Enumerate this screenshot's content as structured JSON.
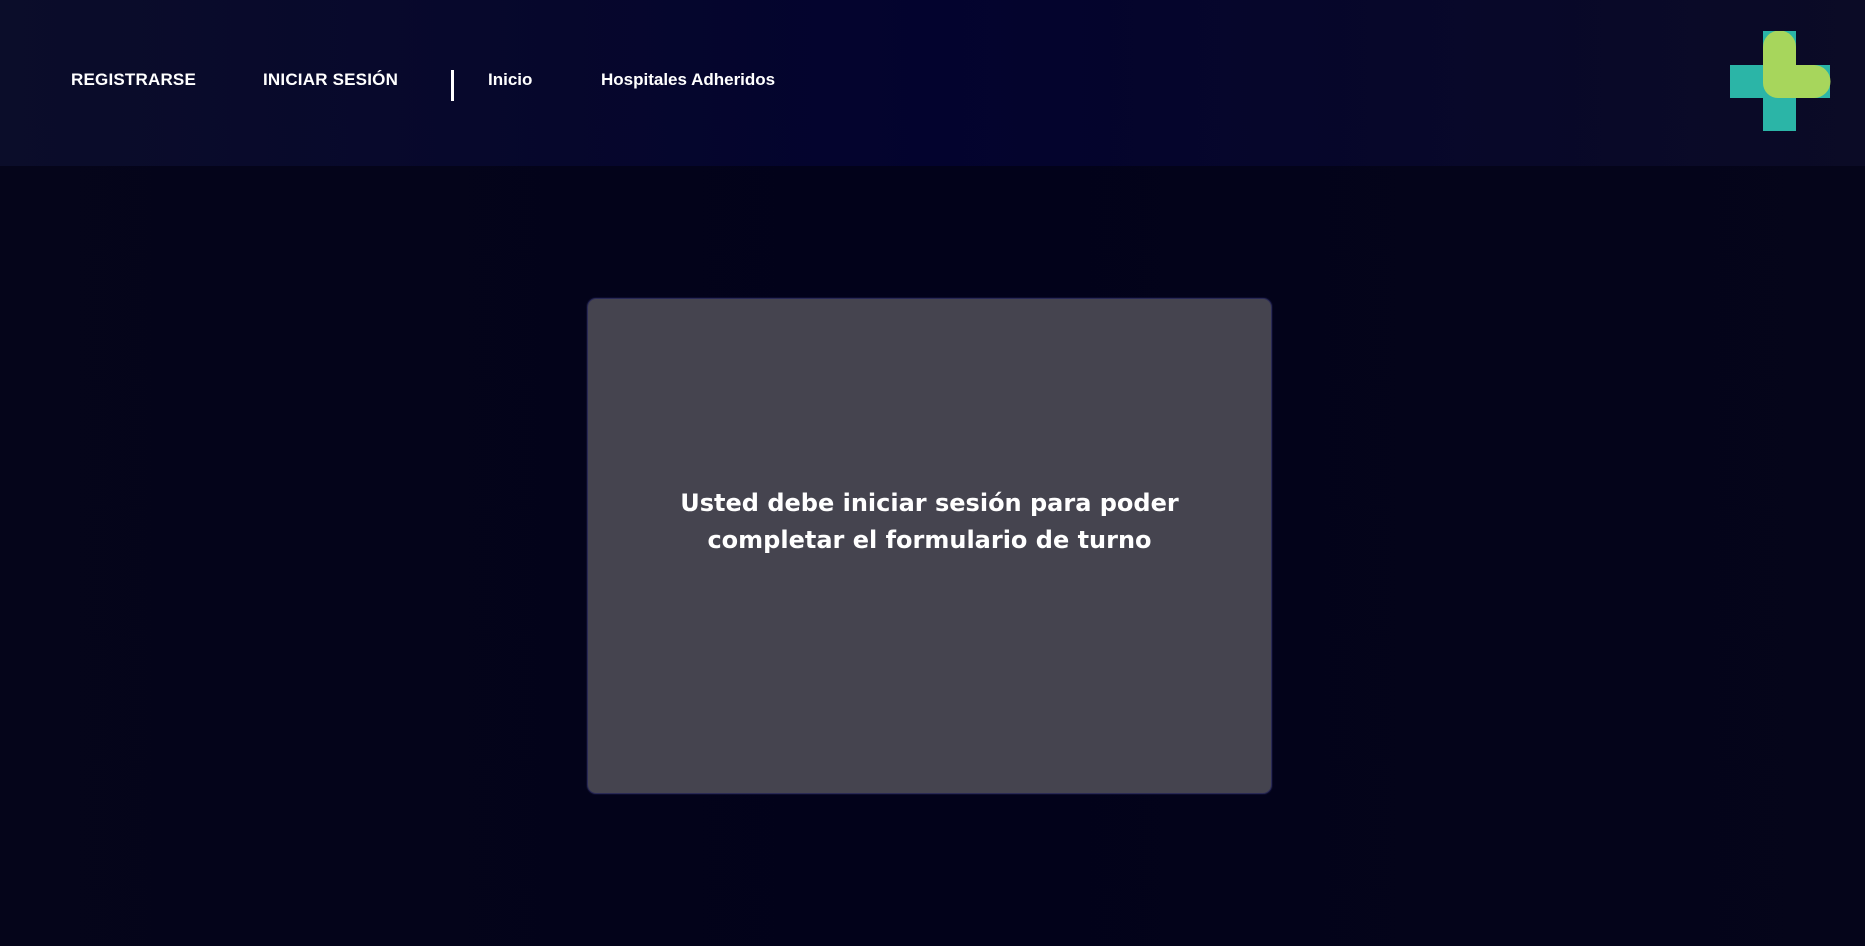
{
  "nav": {
    "register": "REGISTRARSE",
    "login": "INICIAR SESIÓN",
    "home": "Inicio",
    "hospitals": "Hospitales Adheridos"
  },
  "logo": {
    "icon": "medical-cross-icon",
    "colors": [
      "#2bb5a7",
      "#a7d65c"
    ]
  },
  "card": {
    "message": "Usted debe iniciar sesión para poder completar el formulario de turno"
  }
}
